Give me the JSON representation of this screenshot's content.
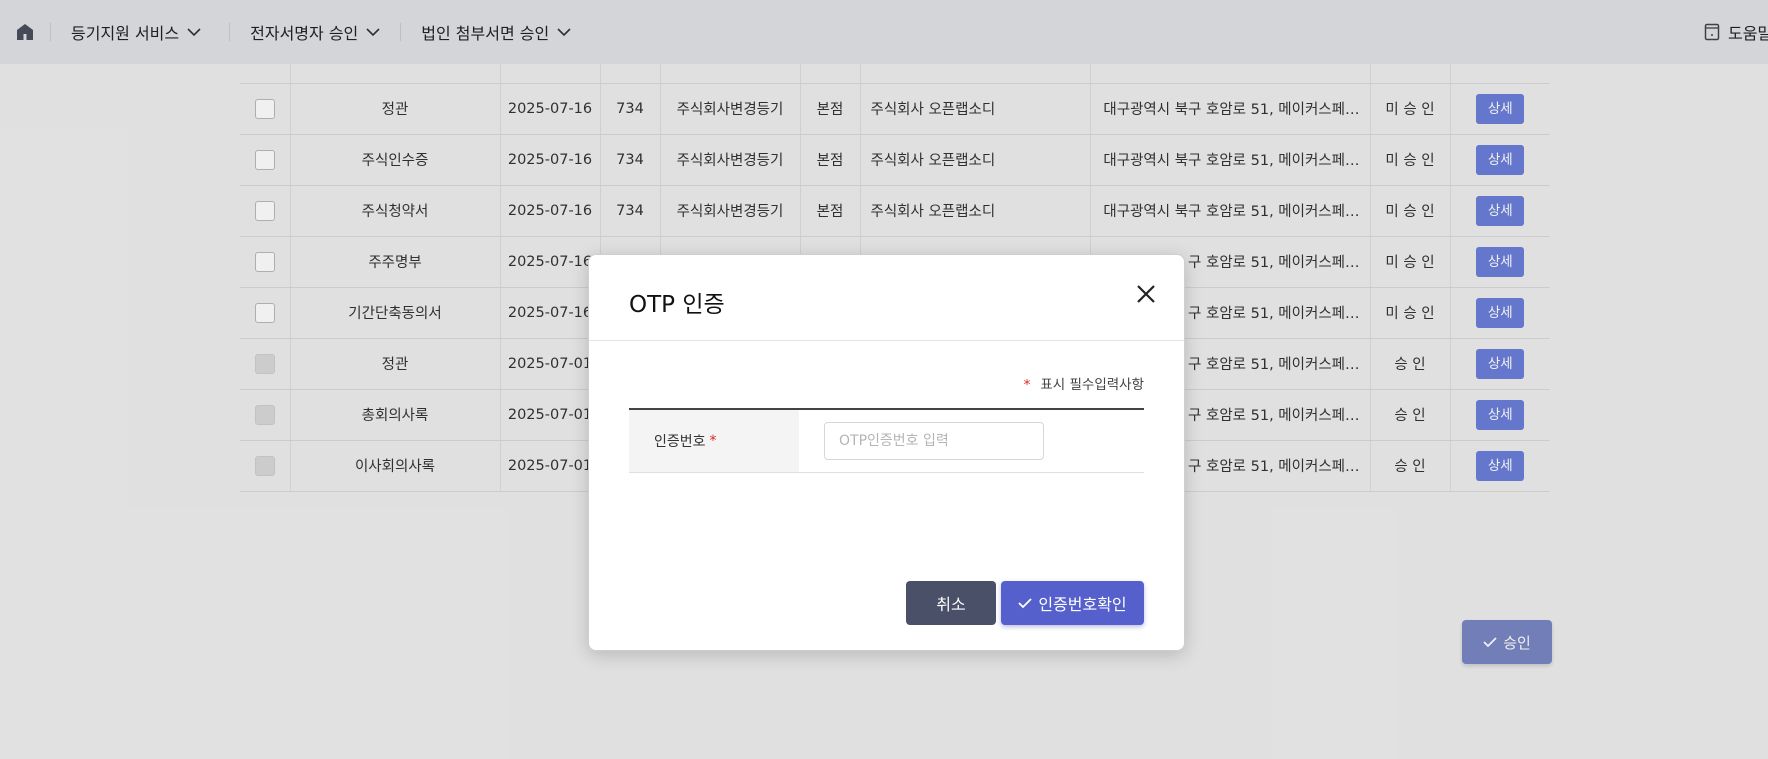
{
  "nav": {
    "crumbs": [
      {
        "label": "등기지원 서비스"
      },
      {
        "label": "전자서명자 승인"
      },
      {
        "label": "법인 첨부서면 승인"
      }
    ],
    "help_label": "도움말"
  },
  "table": {
    "rows": [
      {
        "doc": "정관",
        "date": "2025-07-16",
        "no": "734",
        "type": "주식회사변경등기",
        "branch": "본점",
        "company": "주식회사 오픈랩소디",
        "address": "대구광역시 북구 호암로 51, 메이커스페…",
        "status": "미 승 인",
        "detail": "상세",
        "checkbox_disabled": false
      },
      {
        "doc": "주식인수증",
        "date": "2025-07-16",
        "no": "734",
        "type": "주식회사변경등기",
        "branch": "본점",
        "company": "주식회사 오픈랩소디",
        "address": "대구광역시 북구 호암로 51, 메이커스페…",
        "status": "미 승 인",
        "detail": "상세",
        "checkbox_disabled": false
      },
      {
        "doc": "주식청약서",
        "date": "2025-07-16",
        "no": "734",
        "type": "주식회사변경등기",
        "branch": "본점",
        "company": "주식회사 오픈랩소디",
        "address": "대구광역시 북구 호암로 51, 메이커스페…",
        "status": "미 승 인",
        "detail": "상세",
        "checkbox_disabled": false
      },
      {
        "doc": "주주명부",
        "date": "2025-07-16",
        "no": "",
        "type": "",
        "branch": "",
        "company": "",
        "address": "구 호암로 51, 메이커스페…",
        "status": "미 승 인",
        "detail": "상세",
        "checkbox_disabled": false
      },
      {
        "doc": "기간단축동의서",
        "date": "2025-07-16",
        "no": "",
        "type": "",
        "branch": "",
        "company": "",
        "address": "구 호암로 51, 메이커스페…",
        "status": "미 승 인",
        "detail": "상세",
        "checkbox_disabled": false
      },
      {
        "doc": "정관",
        "date": "2025-07-01",
        "no": "",
        "type": "",
        "branch": "",
        "company": "",
        "address": "구 호암로 51, 메이커스페…",
        "status": "승 인",
        "detail": "상세",
        "checkbox_disabled": true
      },
      {
        "doc": "총회의사록",
        "date": "2025-07-01",
        "no": "",
        "type": "",
        "branch": "",
        "company": "",
        "address": "구 호암로 51, 메이커스페…",
        "status": "승 인",
        "detail": "상세",
        "checkbox_disabled": true
      },
      {
        "doc": "이사회의사록",
        "date": "2025-07-01",
        "no": "",
        "type": "",
        "branch": "",
        "company": "",
        "address": "구 호암로 51, 메이커스페…",
        "status": "승 인",
        "detail": "상세",
        "checkbox_disabled": true
      }
    ],
    "approve_label": "승인"
  },
  "modal": {
    "title": "OTP 인증",
    "required_star": "*",
    "required_note": "표시 필수입력사항",
    "otp_label": "인증번호",
    "otp_value": "",
    "otp_placeholder": "OTP인증번호 입력",
    "cancel_label": "취소",
    "confirm_label": "인증번호확인"
  }
}
